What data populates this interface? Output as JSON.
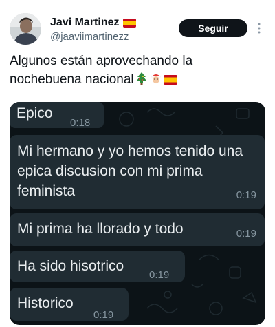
{
  "tweet": {
    "display_name": "Javi Martinez",
    "handle": "@jaaviimartinezz",
    "follow_label": "Seguir",
    "text": "Algunos están aprovechando la nochebuena nacional",
    "emojis": [
      "christmas-tree",
      "santa-face",
      "spain-flag"
    ]
  },
  "chat": {
    "messages": [
      {
        "text": "Epico",
        "time": "0:18"
      },
      {
        "text": "Mi hermano y yo hemos tenido una epica discusion con mi prima feminista",
        "time": "0:19"
      },
      {
        "text": "Mi prima ha llorado y todo",
        "time": "0:19"
      },
      {
        "text": "Ha sido hisotrico",
        "time": "0:19"
      },
      {
        "text": "Historico",
        "time": "0:19"
      }
    ]
  },
  "colors": {
    "follow_button": "#0f1419",
    "chat_background": "#0c1317",
    "bubble": "#202c33",
    "bubble_text": "#e9edef",
    "timestamp": "#8696a0"
  }
}
